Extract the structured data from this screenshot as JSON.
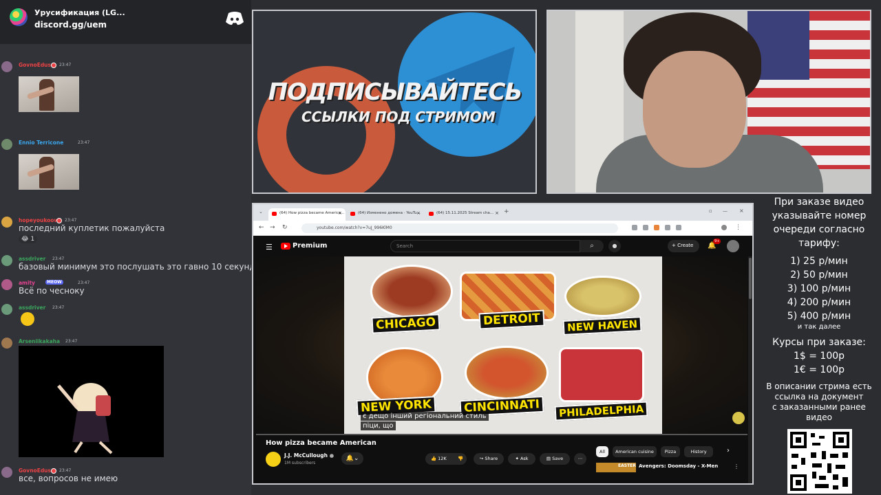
{
  "discord": {
    "server_name": "Урусификация (LG...",
    "invite": "discord.gg/uem",
    "messages": [
      {
        "user": "GovnoEdus",
        "time": "23:47",
        "color": "#ed4245",
        "type": "image"
      },
      {
        "user": "Ennio Terricone",
        "time": "23:47",
        "color": "#3ba8f0",
        "type": "image"
      },
      {
        "user": "hopeyoukoow",
        "time": "23:47",
        "color": "#ed4245",
        "text": "последний куплетик пожалуйста",
        "reactions": "😂 1"
      },
      {
        "user": "assdriver",
        "time": "23:47",
        "color": "#3ba55d",
        "text": "базовый минимум это послушать это гавно 10 секунд"
      },
      {
        "user": "amity",
        "tag": "MEOW",
        "time": "23:47",
        "color": "#e84393",
        "text": "Всё по чесноку"
      },
      {
        "user": "assdriver",
        "time": "23:47",
        "color": "#3ba55d",
        "type": "emoji"
      },
      {
        "user": "Arseniikakaha",
        "time": "23:47",
        "color": "#3ba55d",
        "type": "gif"
      },
      {
        "user": "GovnoEdus",
        "time": "23:47",
        "color": "#ed4245",
        "text": "все, вопросов не имею"
      }
    ]
  },
  "banner": {
    "line1": "ПОДПИСЫВАЙТЕСЬ",
    "line2": "ССЫЛКИ ПОД СТРИМОМ"
  },
  "browser": {
    "tabs": [
      {
        "title": "(64) How pizza became America...",
        "active": true
      },
      {
        "title": "(64) Изменено домена · YouTu...",
        "active": false
      },
      {
        "title": "(64) 15.11.2025 Stream cha...",
        "active": false
      }
    ],
    "url": "youtube.com/watch?v=7uJ_996KlM0",
    "youtube": {
      "brand": "Premium",
      "search_placeholder": "Search",
      "create_label": "Create",
      "notif_count": "9+",
      "video_title": "How pizza became American",
      "channel": "J.J. McCullough",
      "subscribers": "1M subscribers",
      "likes": "12K",
      "share": "Share",
      "ask": "Ask",
      "save": "Save",
      "subtitle_line1": "є дещо інший регіональний стиль",
      "subtitle_line2": "піци, що",
      "progress": 0.0,
      "chips": [
        "All",
        "American cuisine",
        "Pizza",
        "History"
      ],
      "recommended_title": "Avengers: Doomsday - X-Men",
      "recommended_thumb_text": "EASTER",
      "pizza_labels": [
        "CHICAGO",
        "DETROIT",
        "NEW HAVEN",
        "NEW YORK",
        "CINCINNATI",
        "PHILADELPHIA"
      ]
    }
  },
  "info": {
    "l1": "При заказе видео",
    "l2": "указывайте номер",
    "l3": "очереди согласно",
    "l4": "тарифу:",
    "t1": "1) 25 р/мин",
    "t2": "2) 50 р/мин",
    "t3": "3) 100 р/мин",
    "t4": "4) 200 р/мин",
    "t5": "5) 400 р/мин",
    "etc": "и так далее",
    "rates_title": "Курсы при заказе:",
    "r1": "1$ = 100р",
    "r2": "1€ = 100р",
    "d1": "В описании стрима есть",
    "d2": "ссылка на документ",
    "d3": "с заказанными ранее",
    "d4": "видео"
  },
  "colors": {
    "discord_bg": "#313338",
    "youtube_red": "#ff0000",
    "label_yellow": "#ffe400"
  }
}
